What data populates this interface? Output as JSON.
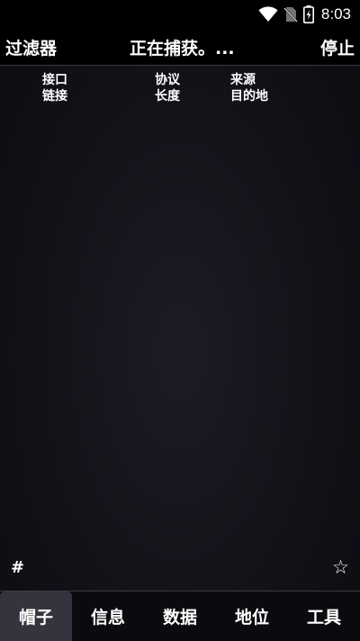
{
  "status_bar": {
    "time": "8:03",
    "icons": [
      "wifi-icon",
      "no-sim-icon",
      "battery-charging-icon"
    ]
  },
  "action_bar": {
    "filter_label": "过滤器",
    "capture_status": "正在捕获。...",
    "stop_label": "停止"
  },
  "columns": {
    "col_a": {
      "line1": "接口",
      "line2": "链接"
    },
    "col_b": {
      "line1": "协议",
      "line2": "长度"
    },
    "col_c": {
      "line1": "来源",
      "line2": "目的地"
    }
  },
  "footer_icons": {
    "hash": "#",
    "star": "☆"
  },
  "bottom_nav": {
    "tabs": [
      {
        "label": "帽子",
        "active": true
      },
      {
        "label": "信息",
        "active": false
      },
      {
        "label": "数据",
        "active": false
      },
      {
        "label": "地位",
        "active": false
      },
      {
        "label": "工具",
        "active": false
      }
    ]
  },
  "colors": {
    "background": "#121218",
    "bar": "#000000",
    "active_tab": "#34343e",
    "text": "#ffffff"
  }
}
